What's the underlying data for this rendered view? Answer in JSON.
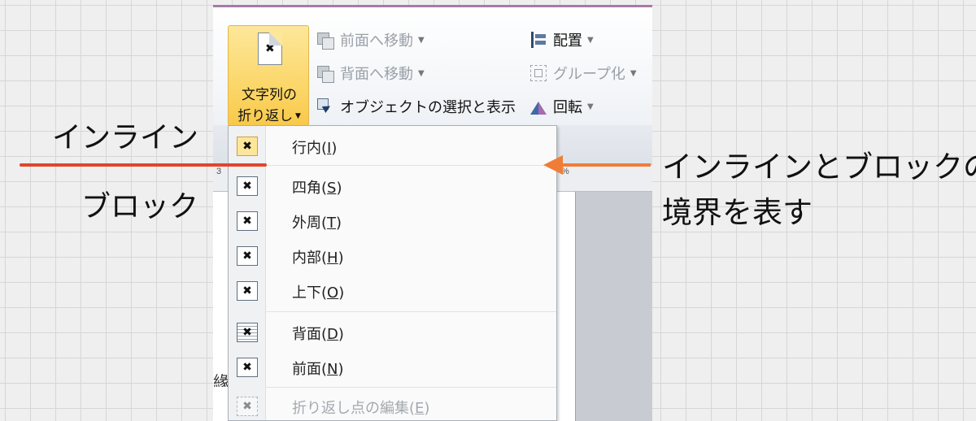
{
  "annotations": {
    "inline_label": "インライン",
    "block_label": "ブロック",
    "boundary_line1": "インラインとブロックの",
    "boundary_line2": "境界を表す",
    "colors": {
      "red_line": "#e2452b",
      "arrow": "#ef7d38"
    }
  },
  "ribbon": {
    "wrap_text": {
      "label_line1": "文字列の",
      "label_line2": "折り返し",
      "icon": "document-wrap-icon"
    },
    "bring_forward": {
      "label": "前面へ移動",
      "enabled": false
    },
    "send_backward": {
      "label": "背面へ移動",
      "enabled": false
    },
    "selection_pane": {
      "label": "オブジェクトの選択と表示",
      "enabled": true
    },
    "align": {
      "label": "配置",
      "enabled": true
    },
    "group": {
      "label": "グループ化",
      "enabled": false
    },
    "rotate": {
      "label": "回転",
      "enabled": true
    }
  },
  "ruler": {
    "tick_left": "3",
    "tick_right": "%"
  },
  "document": {
    "partial_char": "緣"
  },
  "wrap_menu": {
    "items": [
      {
        "label": "行内(I)",
        "mnemonic_before": "行内(",
        "mnemonic": "I",
        "mnemonic_after": ")",
        "checked": true,
        "enabled": true
      },
      {
        "label": "四角(S)",
        "mnemonic_before": "四角(",
        "mnemonic": "S",
        "mnemonic_after": ")",
        "checked": false,
        "enabled": true
      },
      {
        "label": "外周(T)",
        "mnemonic_before": "外周(",
        "mnemonic": "T",
        "mnemonic_after": ")",
        "checked": false,
        "enabled": true
      },
      {
        "label": "内部(H)",
        "mnemonic_before": "内部(",
        "mnemonic": "H",
        "mnemonic_after": ")",
        "checked": false,
        "enabled": true
      },
      {
        "label": "上下(O)",
        "mnemonic_before": "上下(",
        "mnemonic": "O",
        "mnemonic_after": ")",
        "checked": false,
        "enabled": true
      },
      {
        "label": "背面(D)",
        "mnemonic_before": "背面(",
        "mnemonic": "D",
        "mnemonic_after": ")",
        "checked": false,
        "enabled": true
      },
      {
        "label": "前面(N)",
        "mnemonic_before": "前面(",
        "mnemonic": "N",
        "mnemonic_after": ")",
        "checked": false,
        "enabled": true
      },
      {
        "label": "折り返し点の編集(E)",
        "mnemonic_before": "折り返し点の編集(",
        "mnemonic": "E",
        "mnemonic_after": ")",
        "checked": false,
        "enabled": false
      }
    ]
  }
}
